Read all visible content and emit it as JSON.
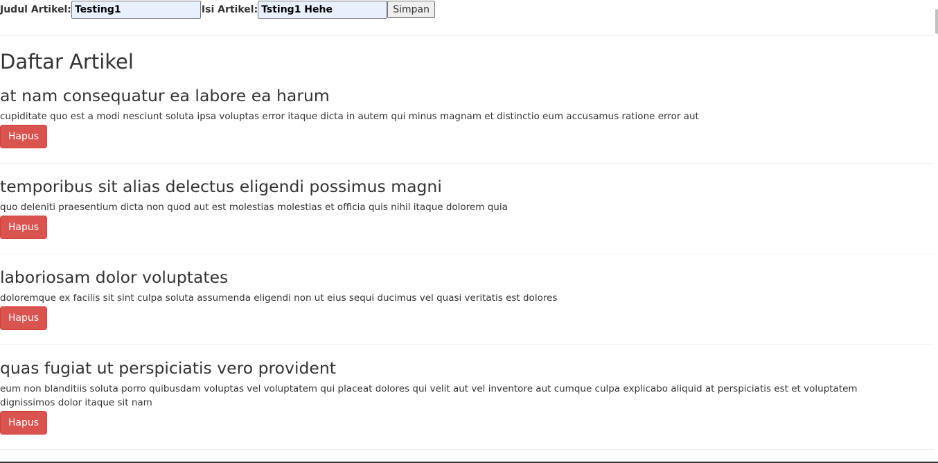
{
  "form": {
    "title_label": "Judul Artikel:",
    "title_value": "Testing1",
    "content_label": "Isi Artikel:",
    "content_value": "Tsting1 Hehe",
    "save_label": "Simpan"
  },
  "list": {
    "heading": "Daftar Artikel",
    "articles": [
      {
        "title": "at nam consequatur ea labore ea harum",
        "body": "cupiditate quo est a modi nesciunt soluta ipsa voluptas error itaque dicta in autem qui minus magnam et distinctio eum accusamus ratione error aut",
        "delete_label": "Hapus"
      },
      {
        "title": "temporibus sit alias delectus eligendi possimus magni",
        "body": "quo deleniti praesentium dicta non quod aut est molestias molestias et officia quis nihil itaque dolorem quia",
        "delete_label": "Hapus"
      },
      {
        "title": "laboriosam dolor voluptates",
        "body": "doloremque ex facilis sit sint culpa soluta assumenda eligendi non ut eius sequi ducimus vel quasi veritatis est dolores",
        "delete_label": "Hapus"
      },
      {
        "title": "quas fugiat ut perspiciatis vero provident",
        "body": "eum non blanditiis soluta porro quibusdam voluptas vel voluptatem qui placeat dolores qui velit aut vel inventore aut cumque culpa explicabo aliquid at perspiciatis est et voluptatem dignissimos dolor itaque sit nam",
        "delete_label": "Hapus"
      }
    ]
  },
  "colors": {
    "danger": "#d9534f",
    "autofill_bg": "#e8f0fe",
    "divider": "#eeeeee"
  }
}
